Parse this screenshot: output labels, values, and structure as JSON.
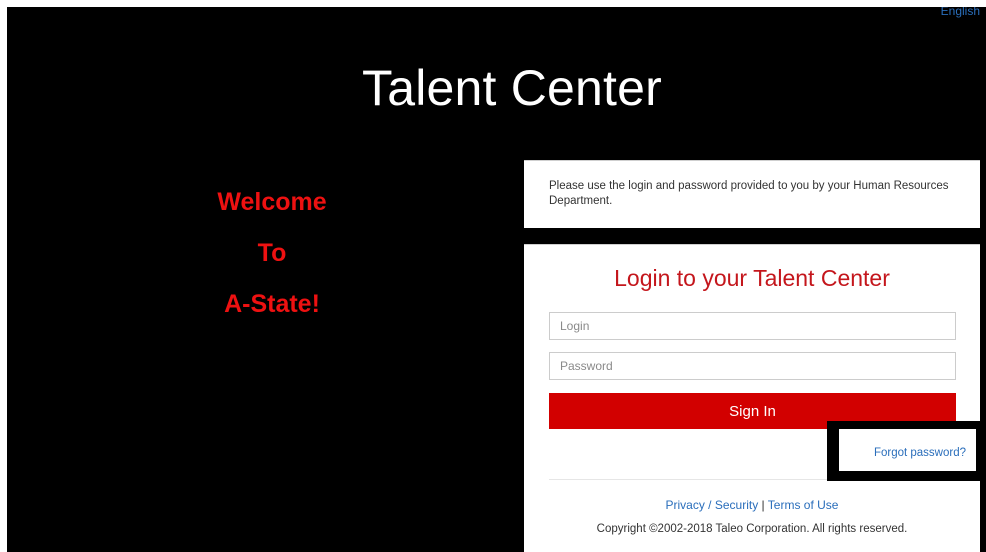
{
  "header": {
    "language_link": "English",
    "app_title": "Talent Center"
  },
  "welcome": {
    "lines": [
      "Welcome",
      "To",
      "A-State!"
    ]
  },
  "notice": {
    "text": "Please use the login and password provided to you by your Human Resources Department."
  },
  "login": {
    "heading": "Login to your Talent Center",
    "login_placeholder": "Login",
    "password_placeholder": "Password",
    "signin_label": "Sign In",
    "forgot_label": "Forgot password?"
  },
  "footer": {
    "privacy_label": "Privacy / Security",
    "separator": "|",
    "terms_label": "Terms of Use",
    "copyright": "Copyright ©2002-2018 Taleo Corporation. All rights reserved."
  },
  "colors": {
    "background": "#000000",
    "accent_red": "#d20000",
    "heading_red": "#c4161c",
    "welcome_red": "#ee1111",
    "link_blue": "#2a6ebb"
  }
}
